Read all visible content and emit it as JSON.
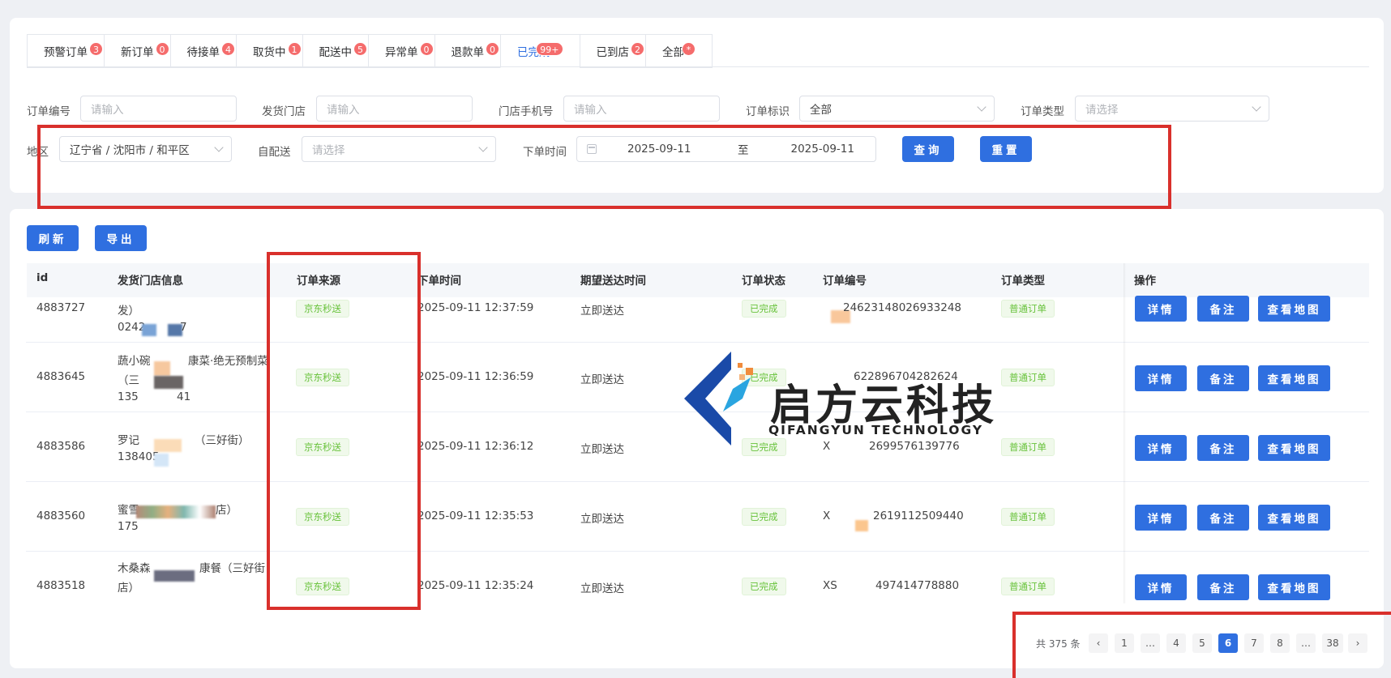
{
  "tabs": [
    {
      "label": "预警订单",
      "badge": "3"
    },
    {
      "label": "新订单",
      "badge": "0"
    },
    {
      "label": "待接单",
      "badge": "4"
    },
    {
      "label": "取货中",
      "badge": "1"
    },
    {
      "label": "配送中",
      "badge": "5"
    },
    {
      "label": "异常单",
      "badge": "0"
    },
    {
      "label": "退款单",
      "badge": "0"
    },
    {
      "label": "已完成",
      "badge": "99+"
    },
    {
      "label": "已到店",
      "badge": "2"
    },
    {
      "label": "全部",
      "badge": "*"
    }
  ],
  "filters": {
    "order_no_label": "订单编号",
    "store_label": "发货门店",
    "phone_label": "门店手机号",
    "tag_label": "订单标识",
    "type_label": "订单类型",
    "region_label": "地区",
    "self_label": "自配送",
    "time_label": "下单时间",
    "input_placeholder": "请输入",
    "select_placeholder": "请选择",
    "tag_value": "全部",
    "region_value": "辽宁省 / 沈阳市 / 和平区",
    "date_start": "2025-09-11",
    "date_sep": "至",
    "date_end": "2025-09-11",
    "query_label": "查询",
    "reset_label": "重置"
  },
  "toolbar": {
    "refresh_label": "刷新",
    "export_label": "导出"
  },
  "table": {
    "headers": {
      "id": "id",
      "store": "发货门店信息",
      "source": "订单来源",
      "time": "下单时间",
      "expect": "期望送达时间",
      "status": "订单状态",
      "order_no": "订单编号",
      "type": "订单类型",
      "ops": "操作"
    },
    "rows": [
      {
        "id": "4883727",
        "store1": "发）",
        "store2": "0242",
        "store3": "7",
        "source": "京东秒送",
        "time": "2025-09-11 12:37:59",
        "expect": "立即送达",
        "status": "已完成",
        "order_no": "24623148026933248",
        "type": "普通订单"
      },
      {
        "id": "4883645",
        "store1": "蔬小碗",
        "store1b": "康菜·绝无预制菜",
        "store2": "（三",
        "store3": "135",
        "store3b": "41",
        "source": "京东秒送",
        "time": "2025-09-11 12:36:59",
        "expect": "立即送达",
        "status": "已完成",
        "order_no": "622896704282624",
        "type": "普通订单"
      },
      {
        "id": "4883586",
        "store1": "罗记",
        "store1b": "（三好街）",
        "store2": "138405",
        "source": "京东秒送",
        "time": "2025-09-11 12:36:12",
        "expect": "立即送达",
        "status": "已完成",
        "order_no_prefix": "X",
        "order_no": "2699576139776",
        "type": "普通订单"
      },
      {
        "id": "4883560",
        "store1": "蜜雪",
        "store1b": "店）",
        "store2": "175",
        "source": "京东秒送",
        "time": "2025-09-11 12:35:53",
        "expect": "立即送达",
        "status": "已完成",
        "order_no_prefix": "X",
        "order_no": "2619112509440",
        "type": "普通订单"
      },
      {
        "id": "4883518",
        "store1": "木桑森",
        "store1b": "康餐（三好街",
        "store2": "店）",
        "source": "京东秒送",
        "time": "2025-09-11 12:35:24",
        "expect": "立即送达",
        "status": "已完成",
        "order_no_prefix": "XS",
        "order_no": "497414778880",
        "type": "普通订单"
      }
    ],
    "row_buttons": {
      "detail": "详情",
      "note": "备注",
      "map": "查看地图"
    }
  },
  "pagination": {
    "total": "共 375 条",
    "pages": [
      "1",
      "…",
      "4",
      "5",
      "6",
      "7",
      "8",
      "…",
      "38"
    ],
    "current": "6"
  },
  "watermark": {
    "cn": "启方云科技",
    "en": "QIFANGYUN TECHNOLOGY"
  },
  "colors": {
    "accent": "#2f6fe0",
    "badge": "#f56c6c",
    "tag_green": "#67c23a",
    "highlight": "#d9302c"
  }
}
